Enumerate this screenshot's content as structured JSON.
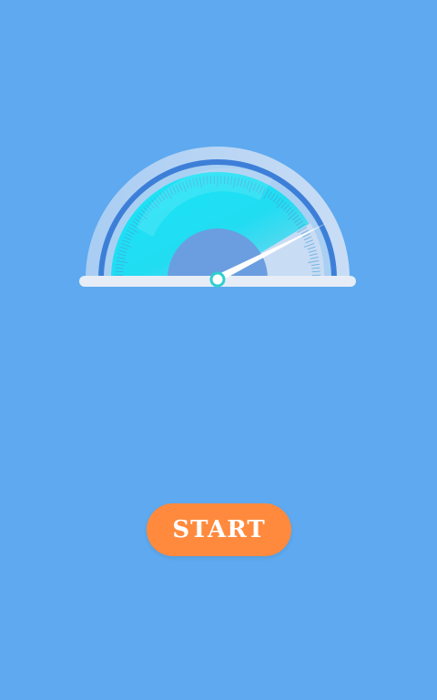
{
  "speed_gauge": {
    "needle_level": 0.85
  },
  "start_button": {
    "label": "START"
  },
  "colors": {
    "background": "#5ea9ef",
    "gauge_outer_ring": "#9cc4f0",
    "gauge_rim": "#3c7fd6",
    "gauge_face_start": "#1fe3f5",
    "gauge_face_end": "#7fd9f0",
    "gauge_hub": "#6d9fe0",
    "needle": "#ffffff",
    "needle_pivot": "#2fd3cf",
    "base_bar": "#e8eef6",
    "start_button": "#ff8a3d",
    "start_button_text": "#ffffff"
  }
}
